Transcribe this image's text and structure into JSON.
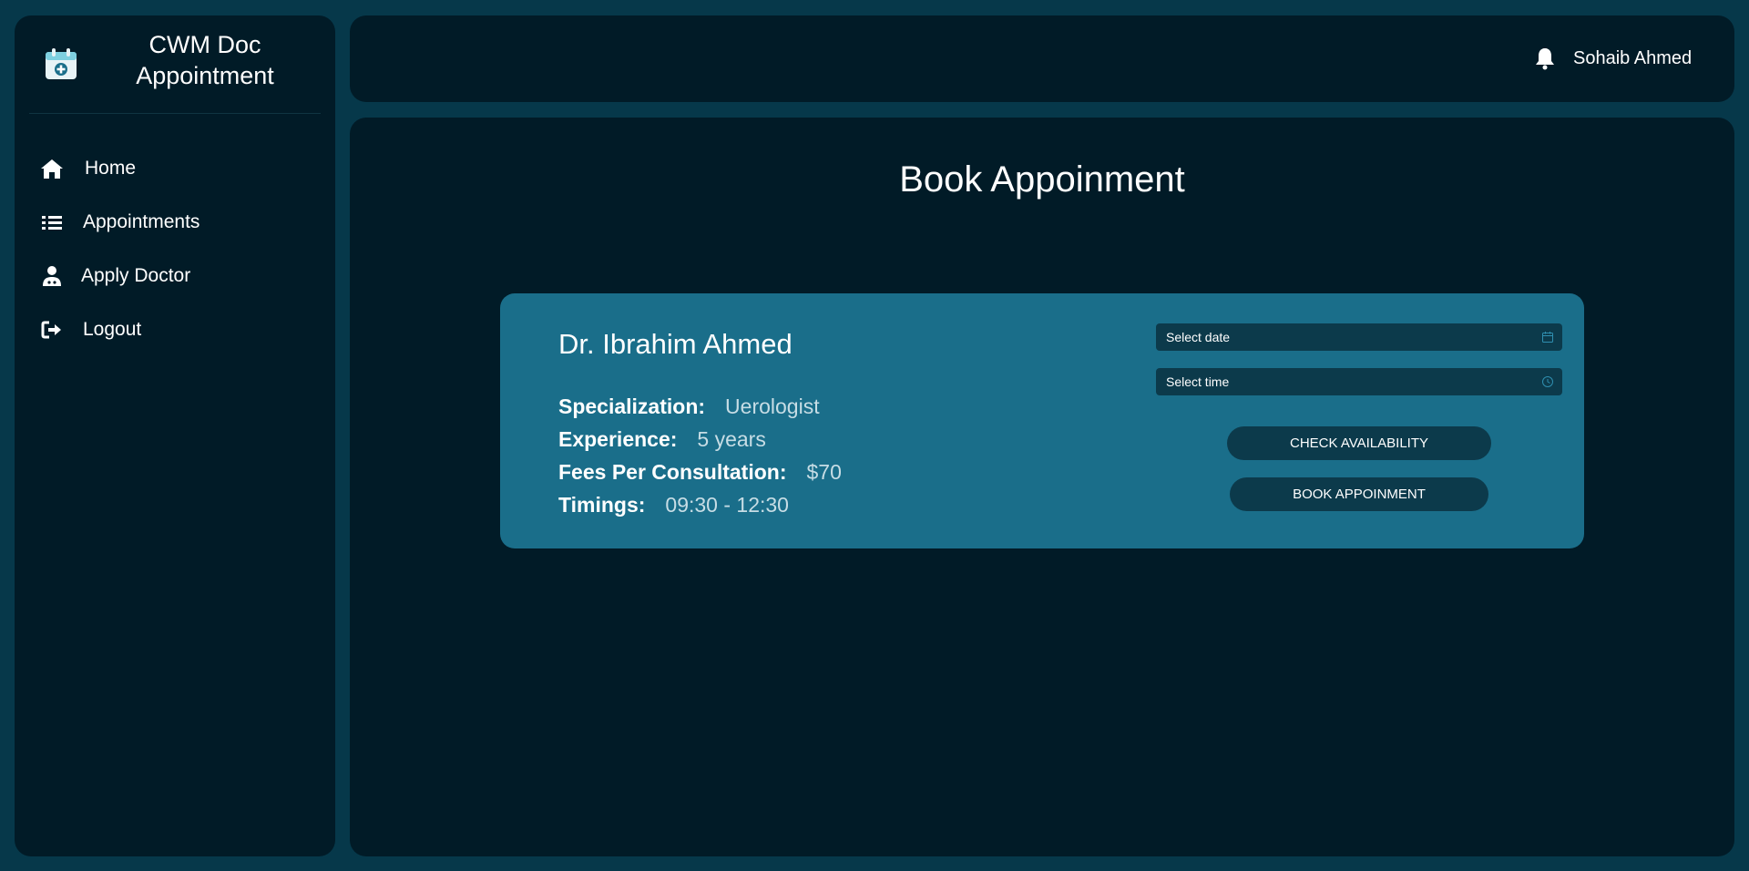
{
  "sidebar": {
    "brand": {
      "title": "CWM Doc\nAppointment",
      "icon": "calendar-plus-icon"
    },
    "items": [
      {
        "label": "Home",
        "icon": "home-icon"
      },
      {
        "label": "Appointments",
        "icon": "list-icon"
      },
      {
        "label": "Apply Doctor",
        "icon": "user-doctor-icon"
      },
      {
        "label": "Logout",
        "icon": "logout-icon"
      }
    ]
  },
  "header": {
    "notification_icon": "bell-icon",
    "user_name": "Sohaib Ahmed"
  },
  "main": {
    "title": "Book Appoinment",
    "doctor": {
      "name": "Dr. Ibrahim Ahmed",
      "details": [
        {
          "label": "Specialization:",
          "value": "Uerologist"
        },
        {
          "label": "Experience:",
          "value": "5 years"
        },
        {
          "label": "Fees Per Consultation:",
          "value": "$70"
        },
        {
          "label": "Timings:",
          "value": "09:30 - 12:30"
        }
      ]
    },
    "form": {
      "date_placeholder": "Select date",
      "time_placeholder": "Select time",
      "check_button": "CHECK AVAILABILITY",
      "book_button": "BOOK APPOINMENT"
    }
  },
  "colors": {
    "page_background": "#06384a",
    "panel_background": "#011b27",
    "card_background": "#1a6e8a",
    "control_background": "#0c3a4b",
    "value_text": "#c7dde5"
  }
}
